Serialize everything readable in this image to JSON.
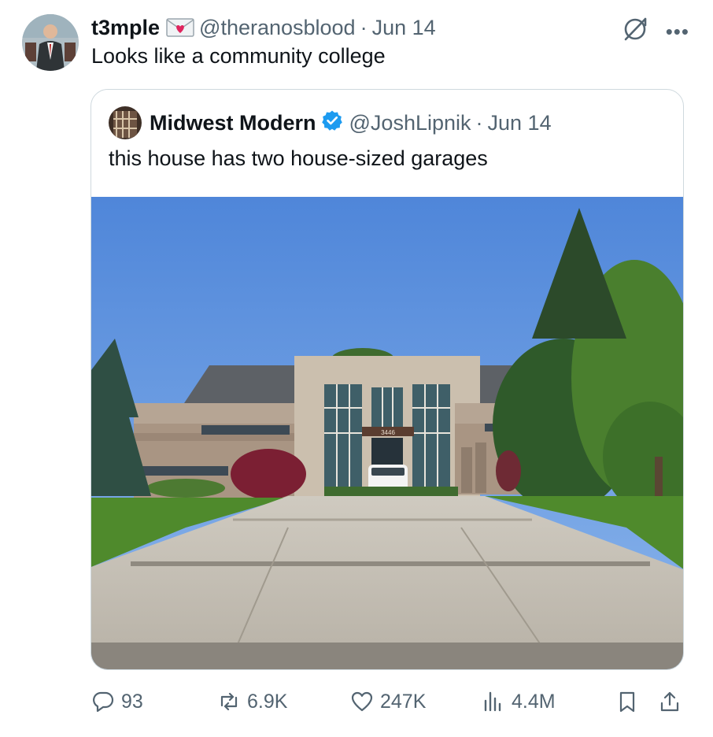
{
  "tweet": {
    "display_name": "t3mple",
    "handle": "@theranosblood",
    "separator": "·",
    "date": "Jun 14",
    "text": "Looks like a community college"
  },
  "quoted_tweet": {
    "display_name": "Midwest Modern",
    "handle": "@JoshLipnik",
    "separator": "·",
    "date": "Jun 14",
    "text": "this house has two house-sized garages",
    "photo_house_number": "3446"
  },
  "actions": {
    "replies": "93",
    "reposts": "6.9K",
    "likes": "247K",
    "views": "4.4M"
  },
  "icons": {
    "emoji": "love-letter-icon",
    "verified": "verified-badge-icon",
    "top_right": [
      "grok-icon",
      "more-icon"
    ],
    "actions": [
      "reply-icon",
      "repost-icon",
      "like-icon",
      "views-icon",
      "bookmark-icon",
      "share-icon"
    ]
  },
  "colors": {
    "text": "#0f1419",
    "muted": "#536471",
    "verified_blue": "#1d9bf0",
    "border": "#cfd9de"
  }
}
